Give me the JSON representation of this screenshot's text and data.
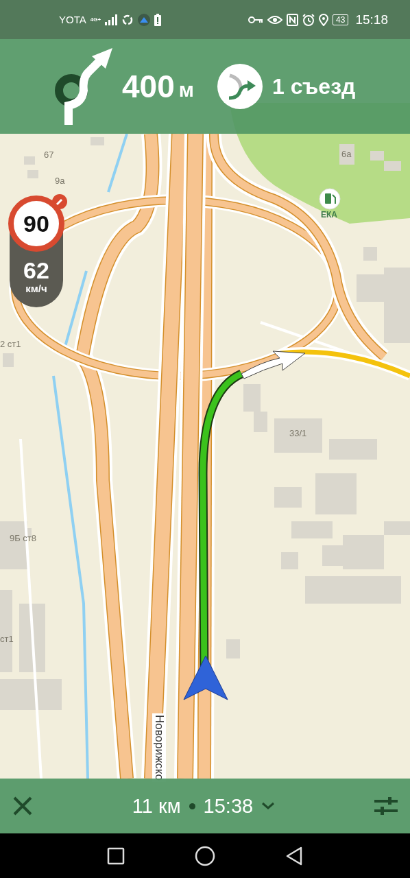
{
  "status_bar": {
    "carrier": "YOTA",
    "network": "4G+",
    "battery": "43",
    "time": "15:18"
  },
  "maneuver": {
    "distance": "400",
    "unit": "м",
    "exit": "1 съезд"
  },
  "speed": {
    "limit": "90",
    "current": "62",
    "unit": "км/ч"
  },
  "map": {
    "labels": [
      {
        "text": "67",
        "kind": "building"
      },
      {
        "text": "9а",
        "kind": "building"
      },
      {
        "text": "6а",
        "kind": "building"
      },
      {
        "text": "ЕКА",
        "kind": "poi"
      },
      {
        "text": "2 ст1",
        "kind": "building"
      },
      {
        "text": "33/1",
        "kind": "building"
      },
      {
        "text": "9Б ст8",
        "kind": "building"
      },
      {
        "text": "ст1",
        "kind": "building"
      },
      {
        "text": "Новорижско",
        "kind": "street"
      }
    ]
  },
  "route_bar": {
    "distance": "11 км",
    "arrival": "15:38"
  }
}
